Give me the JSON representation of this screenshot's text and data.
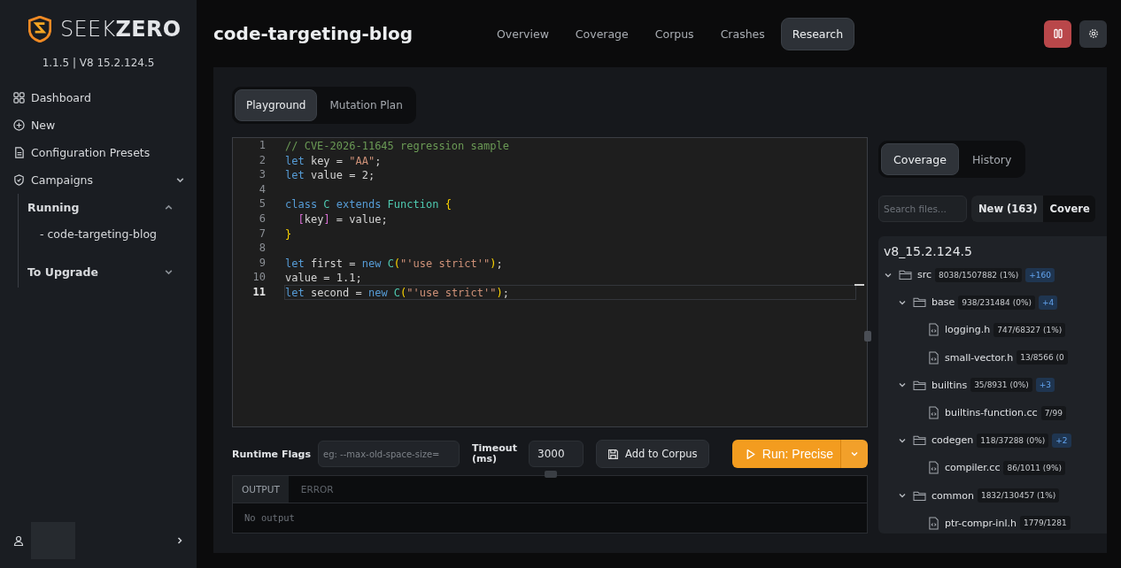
{
  "sidebar": {
    "brand": {
      "first": "SEEK",
      "second": "ZERO"
    },
    "version": "1.1.5 | V8 15.2.124.5",
    "nav": [
      {
        "label": "Dashboard"
      },
      {
        "label": "New"
      },
      {
        "label": "Configuration Presets"
      },
      {
        "label": "Campaigns",
        "expanded": true,
        "groups": [
          {
            "label": "Running",
            "expanded": true,
            "items": [
              "- code-targeting-blog"
            ]
          },
          {
            "label": "To Upgrade",
            "expanded": false
          }
        ]
      }
    ]
  },
  "header": {
    "title": "code-targeting-blog",
    "tabs": [
      {
        "label": "Overview",
        "selected": false
      },
      {
        "label": "Coverage",
        "selected": false
      },
      {
        "label": "Corpus",
        "selected": false
      },
      {
        "label": "Crashes",
        "selected": false
      },
      {
        "label": "Research",
        "selected": true
      }
    ]
  },
  "research": {
    "subtabs": [
      {
        "label": "Playground",
        "selected": true
      },
      {
        "label": "Mutation Plan",
        "selected": false
      }
    ],
    "editor": {
      "lines": [
        {
          "number": "1",
          "selected": false,
          "tokens": [
            {
              "text": "// CVE-2026-11645 regression sample",
              "kind": "comment"
            }
          ]
        },
        {
          "number": "2",
          "selected": false,
          "tokens": [
            {
              "text": "let",
              "kind": "keyword"
            },
            {
              "text": " key = ",
              "kind": "plain"
            },
            {
              "text": "\"AA\"",
              "kind": "string"
            },
            {
              "text": ";",
              "kind": "plain"
            }
          ]
        },
        {
          "number": "3",
          "selected": false,
          "tokens": [
            {
              "text": "let",
              "kind": "keyword"
            },
            {
              "text": " value = 2;",
              "kind": "plain"
            }
          ]
        },
        {
          "number": "4",
          "selected": false
        },
        {
          "number": "5",
          "selected": false,
          "tokens": [
            {
              "text": "class ",
              "kind": "keyword"
            },
            {
              "text": "C ",
              "kind": "type"
            },
            {
              "text": "extends ",
              "kind": "keyword"
            },
            {
              "text": "Function ",
              "kind": "type"
            },
            {
              "text": "{",
              "kind": "brace"
            }
          ]
        },
        {
          "number": "6",
          "selected": false,
          "tokens": [
            {
              "text": "  [",
              "kind": "bracket"
            },
            {
              "text": "key",
              "kind": "plain"
            },
            {
              "text": "]",
              "kind": "bracket"
            },
            {
              "text": " = value;",
              "kind": "plain"
            }
          ]
        },
        {
          "number": "7",
          "selected": false,
          "tokens": [
            {
              "text": "}",
              "kind": "brace"
            }
          ]
        },
        {
          "number": "8",
          "selected": false
        },
        {
          "number": "9",
          "selected": false,
          "tokens": [
            {
              "text": "let",
              "kind": "keyword"
            },
            {
              "text": " first = ",
              "kind": "plain"
            },
            {
              "text": "new ",
              "kind": "keyword"
            },
            {
              "text": "C",
              "kind": "type"
            },
            {
              "text": "(",
              "kind": "brace"
            },
            {
              "text": "\"'use strict'\"",
              "kind": "string"
            },
            {
              "text": ")",
              "kind": "brace"
            },
            {
              "text": ";",
              "kind": "plain"
            }
          ]
        },
        {
          "number": "10",
          "selected": false,
          "tokens": [
            {
              "text": "value = 1.1;",
              "kind": "plain"
            }
          ]
        },
        {
          "number": "11",
          "selected": true,
          "tokens": [
            {
              "text": "let",
              "kind": "keyword"
            },
            {
              "text": " second = ",
              "kind": "plain"
            },
            {
              "text": "new ",
              "kind": "keyword"
            },
            {
              "text": "C",
              "kind": "type"
            },
            {
              "text": "(",
              "kind": "brace"
            },
            {
              "text": "\"'use strict'\"",
              "kind": "string"
            },
            {
              "text": ")",
              "kind": "brace"
            },
            {
              "text": ";",
              "kind": "plain"
            }
          ]
        }
      ]
    },
    "runtime_flags": {
      "label": "Runtime Flags",
      "placeholder": "eg: --max-old-space-size="
    },
    "timeout": {
      "label": "Timeout (ms)",
      "value": "3000"
    },
    "add_button": "Add to Corpus",
    "run_button": "Run: Precise",
    "output": {
      "tabs": [
        {
          "label": "OUTPUT",
          "selected": true
        },
        {
          "label": "ERROR",
          "selected": false
        }
      ],
      "text": "No output"
    }
  },
  "coverage": {
    "tabs": [
      {
        "label": "Coverage",
        "selected": true
      },
      {
        "label": "History",
        "selected": false
      }
    ],
    "search": {
      "placeholder": "Search files..."
    },
    "filters": [
      {
        "label": "New (163)",
        "selected": true
      },
      {
        "label": "Covere",
        "selected": false
      }
    ],
    "tree": {
      "root": "v8_15.2.124.5",
      "nodes": [
        {
          "kind": "folder",
          "name": "src",
          "count": "8038/1507882 (1%)",
          "delta": "+160",
          "expanded": true,
          "children": [
            {
              "kind": "folder",
              "name": "base",
              "count": "938/231484 (0%)",
              "delta": "+4",
              "expanded": true,
              "children": [
                {
                  "kind": "file",
                  "name": "logging.h",
                  "count": "747/68327 (1%)"
                },
                {
                  "kind": "file",
                  "name": "small-vector.h",
                  "count": "13/8566 (0"
                }
              ]
            },
            {
              "kind": "folder",
              "name": "builtins",
              "count": "35/8931 (0%)",
              "delta": "+3",
              "expanded": true,
              "children": [
                {
                  "kind": "file",
                  "name": "builtins-function.cc",
                  "count": "7/99"
                }
              ]
            },
            {
              "kind": "folder",
              "name": "codegen",
              "count": "118/37288 (0%)",
              "delta": "+2",
              "expanded": true,
              "children": [
                {
                  "kind": "file",
                  "name": "compiler.cc",
                  "count": "86/1011 (9%)"
                }
              ]
            },
            {
              "kind": "folder",
              "name": "common",
              "count": "1832/130457 (1%)",
              "expanded": true,
              "children": [
                {
                  "kind": "file",
                  "name": "ptr-compr-inl.h",
                  "count": "1779/1281"
                }
              ]
            }
          ]
        }
      ]
    }
  }
}
